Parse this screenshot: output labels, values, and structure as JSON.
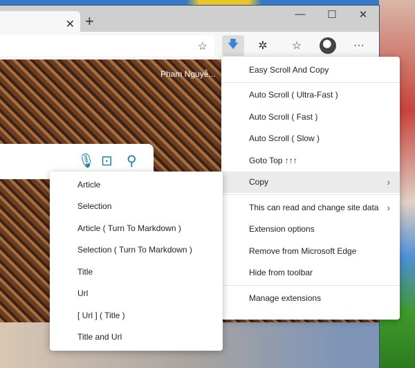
{
  "browser": {
    "new_tab_label": "+",
    "minimize": "—",
    "maximize": "☐",
    "close": "✕",
    "tab_close": "✕"
  },
  "page": {
    "photo_credit": "Pham Nguyễ..."
  },
  "extension_menu": {
    "title": "Easy Scroll And Copy",
    "items": [
      "Auto Scroll ( Ultra-Fast )",
      "Auto Scroll ( Fast )",
      "Auto Scroll ( Slow )",
      "Goto Top ↑↑↑",
      "Copy"
    ],
    "site_access": "This can read and change site data",
    "options": [
      "Extension options",
      "Remove from Microsoft Edge",
      "Hide from toolbar"
    ],
    "manage": "Manage extensions"
  },
  "copy_submenu": {
    "items": [
      "Article",
      "Selection",
      "Article ( Turn To Markdown )",
      "Selection ( Turn To Markdown )",
      "Title",
      "Url",
      "[ Url ] ( Title )",
      "Title and Url"
    ]
  },
  "colors": {
    "accent": "#3c83d8",
    "search_icons": "#1a7fa8",
    "highlight": "#ebebeb"
  }
}
